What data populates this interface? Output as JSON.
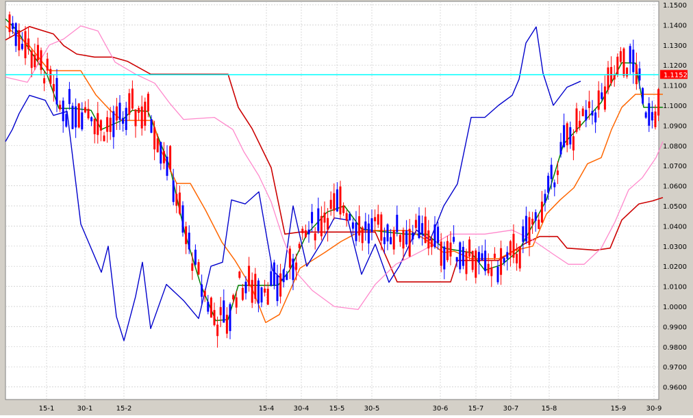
{
  "chart_data": {
    "type": "line",
    "title": "",
    "xlabel": "",
    "ylabel": "",
    "ylim": [
      0.955,
      1.15
    ],
    "x_ticks": [
      "15-1",
      "30-1",
      "15-2",
      "15-4",
      "30-4",
      "15-5",
      "30-5",
      "30-6",
      "15-7",
      "30-7",
      "15-8",
      "15-9",
      "30-9"
    ],
    "y_ticks": [
      "1.1500",
      "1.1400",
      "1.1300",
      "1.1200",
      "1.1100",
      "1.1000",
      "1.0900",
      "1.0800",
      "1.0700",
      "1.0600",
      "1.0500",
      "1.0400",
      "1.0300",
      "1.0200",
      "1.0100",
      "1.0000",
      "0.9900",
      "0.9800",
      "0.9700",
      "0.9600"
    ],
    "grid": true,
    "current_price_label": "1.1152",
    "current_price": 1.1152,
    "colors": {
      "background": "#ffffff",
      "grid": "#c8c8c8",
      "price_line": "#00ffff",
      "price_label": "#ff0000",
      "bull_candle": "#0000ff",
      "bear_candle": "#ff0000",
      "chikou": "#0000cc",
      "kijun": "#008000",
      "tenkan": "#ff6600",
      "senkou_b": "#cc0000",
      "outer_band": "#ff88cc"
    },
    "series": [
      {
        "values": [
          [
            0,
            1.1325
          ],
          [
            35,
            1.1392
          ],
          [
            70,
            1.1355
          ],
          [
            85,
            1.1297
          ],
          [
            104,
            1.1255
          ],
          [
            130,
            1.124
          ],
          [
            156,
            1.124
          ],
          [
            178,
            1.1219
          ],
          [
            212,
            1.1155
          ],
          [
            268,
            1.1155
          ],
          [
            325,
            1.1155
          ],
          [
            340,
            1.099
          ],
          [
            360,
            1.0885
          ],
          [
            388,
            1.069
          ],
          [
            408,
            1.036
          ],
          [
            430,
            1.037
          ],
          [
            480,
            1.037
          ],
          [
            540,
            1.037
          ],
          [
            572,
            1.0122
          ],
          [
            610,
            1.0122
          ],
          [
            650,
            1.0122
          ],
          [
            660,
            1.0229
          ],
          [
            720,
            1.0229
          ],
          [
            760,
            1.0316
          ],
          [
            780,
            1.0348
          ],
          [
            806,
            1.0348
          ],
          [
            820,
            1.029
          ],
          [
            862,
            1.028
          ],
          [
            883,
            1.029
          ],
          [
            900,
            1.043
          ],
          [
            925,
            1.051
          ],
          [
            945,
            1.0525
          ],
          [
            960,
            1.0542
          ]
        ]
      },
      {
        "values": [
          [
            0,
            1.143
          ],
          [
            16,
            1.1375
          ],
          [
            40,
            1.1252
          ],
          [
            61,
            1.115
          ],
          [
            78,
            1.0985
          ],
          [
            100,
            1.0985
          ],
          [
            125,
            1.0975
          ],
          [
            140,
            1.088
          ],
          [
            170,
            1.0925
          ],
          [
            185,
            1.0975
          ],
          [
            208,
            1.097
          ],
          [
            218,
            1.0885
          ],
          [
            240,
            1.0695
          ],
          [
            262,
            1.0365
          ],
          [
            285,
            1.011
          ],
          [
            307,
            0.993
          ],
          [
            325,
            0.9935
          ],
          [
            340,
            1.0105
          ],
          [
            362,
            1.0105
          ],
          [
            398,
            1.0105
          ],
          [
            415,
            1.018
          ],
          [
            440,
            1.036
          ],
          [
            470,
            1.047
          ],
          [
            495,
            1.05
          ],
          [
            520,
            1.0385
          ],
          [
            548,
            1.0373
          ],
          [
            585,
            1.036
          ],
          [
            615,
            1.036
          ],
          [
            640,
            1.029
          ],
          [
            680,
            1.0268
          ],
          [
            700,
            1.018
          ],
          [
            725,
            1.0208
          ],
          [
            750,
            1.028
          ],
          [
            790,
            1.053
          ],
          [
            815,
            1.0808
          ],
          [
            840,
            1.09
          ],
          [
            870,
            1.1015
          ],
          [
            900,
            1.1212
          ],
          [
            920,
            1.121
          ],
          [
            932,
            1.099
          ],
          [
            960,
            1.099
          ]
        ]
      },
      {
        "values": [
          [
            0,
            1.1395
          ],
          [
            34,
            1.13
          ],
          [
            64,
            1.1172
          ],
          [
            110,
            1.1172
          ],
          [
            132,
            1.1052
          ],
          [
            153,
            1.0975
          ],
          [
            170,
            1.0925
          ],
          [
            215,
            1.0925
          ],
          [
            228,
            1.077
          ],
          [
            250,
            1.0612
          ],
          [
            270,
            1.0612
          ],
          [
            292,
            1.048
          ],
          [
            316,
            1.032
          ],
          [
            335,
            1.023
          ],
          [
            360,
            1.009
          ],
          [
            380,
            0.992
          ],
          [
            400,
            0.996
          ],
          [
            430,
            1.019
          ],
          [
            466,
            1.0268
          ],
          [
            490,
            1.0323
          ],
          [
            520,
            1.0378
          ],
          [
            550,
            1.0378
          ],
          [
            590,
            1.0378
          ],
          [
            610,
            1.034
          ],
          [
            640,
            1.0268
          ],
          [
            655,
            1.0275
          ],
          [
            680,
            1.0237
          ],
          [
            720,
            1.0237
          ],
          [
            745,
            1.028
          ],
          [
            770,
            1.03
          ],
          [
            790,
            1.046
          ],
          [
            810,
            1.053
          ],
          [
            830,
            1.059
          ],
          [
            850,
            1.071
          ],
          [
            870,
            1.074
          ],
          [
            885,
            1.088
          ],
          [
            900,
            1.099
          ],
          [
            920,
            1.1055
          ],
          [
            960,
            1.1055
          ]
        ]
      },
      {
        "values": [
          [
            0,
            1.082
          ],
          [
            10,
            1.088
          ],
          [
            20,
            1.096
          ],
          [
            35,
            1.105
          ],
          [
            58,
            1.1025
          ],
          [
            70,
            1.095
          ],
          [
            90,
            1.097
          ],
          [
            110,
            1.041
          ],
          [
            120,
            1.033
          ],
          [
            140,
            1.017
          ],
          [
            150,
            1.03
          ],
          [
            162,
            0.995
          ],
          [
            173,
            0.983
          ],
          [
            190,
            1.005
          ],
          [
            200,
            1.022
          ],
          [
            212,
            0.989
          ],
          [
            235,
            1.011
          ],
          [
            260,
            1.003
          ],
          [
            282,
            0.994
          ],
          [
            300,
            1.02
          ],
          [
            317,
            1.022
          ],
          [
            330,
            1.053
          ],
          [
            350,
            1.051
          ],
          [
            370,
            1.057
          ],
          [
            390,
            1.018
          ],
          [
            405,
            1.013
          ],
          [
            420,
            1.05
          ],
          [
            440,
            1.02
          ],
          [
            460,
            1.031
          ],
          [
            480,
            1.044
          ],
          [
            500,
            1.043
          ],
          [
            520,
            1.016
          ],
          [
            540,
            1.031
          ],
          [
            560,
            1.012
          ],
          [
            575,
            1.02
          ],
          [
            600,
            1.038
          ],
          [
            620,
            1.033
          ],
          [
            640,
            1.05
          ],
          [
            660,
            1.061
          ],
          [
            680,
            1.094
          ],
          [
            700,
            1.094
          ],
          [
            720,
            1.1
          ],
          [
            740,
            1.105
          ],
          [
            750,
            1.113
          ],
          [
            760,
            1.131
          ],
          [
            775,
            1.139
          ],
          [
            785,
            1.116
          ],
          [
            800,
            1.1
          ],
          [
            820,
            1.109
          ],
          [
            840,
            1.112
          ]
        ]
      },
      {
        "values": [
          [
            0,
            1.114
          ],
          [
            32,
            1.1115
          ],
          [
            64,
            1.13
          ],
          [
            85,
            1.133
          ],
          [
            110,
            1.1395
          ],
          [
            135,
            1.137
          ],
          [
            160,
            1.1215
          ],
          [
            190,
            1.1155
          ],
          [
            218,
            1.111
          ],
          [
            240,
            1.101
          ],
          [
            260,
            1.093
          ],
          [
            305,
            1.094
          ],
          [
            332,
            1.088
          ],
          [
            348,
            1.077
          ],
          [
            370,
            1.065
          ],
          [
            388,
            1.052
          ],
          [
            405,
            1.034
          ],
          [
            425,
            1.0168
          ],
          [
            448,
            1.008
          ],
          [
            480,
            1.0
          ],
          [
            515,
            0.9985
          ],
          [
            540,
            1.011
          ],
          [
            570,
            1.021
          ],
          [
            610,
            1.028
          ],
          [
            650,
            1.036
          ],
          [
            700,
            1.036
          ],
          [
            740,
            1.038
          ],
          [
            770,
            1.033
          ],
          [
            800,
            1.026
          ],
          [
            822,
            1.021
          ],
          [
            845,
            1.021
          ],
          [
            870,
            1.029
          ],
          [
            890,
            1.042
          ],
          [
            910,
            1.058
          ],
          [
            930,
            1.064
          ],
          [
            950,
            1.074
          ],
          [
            960,
            1.082
          ]
        ]
      }
    ]
  }
}
